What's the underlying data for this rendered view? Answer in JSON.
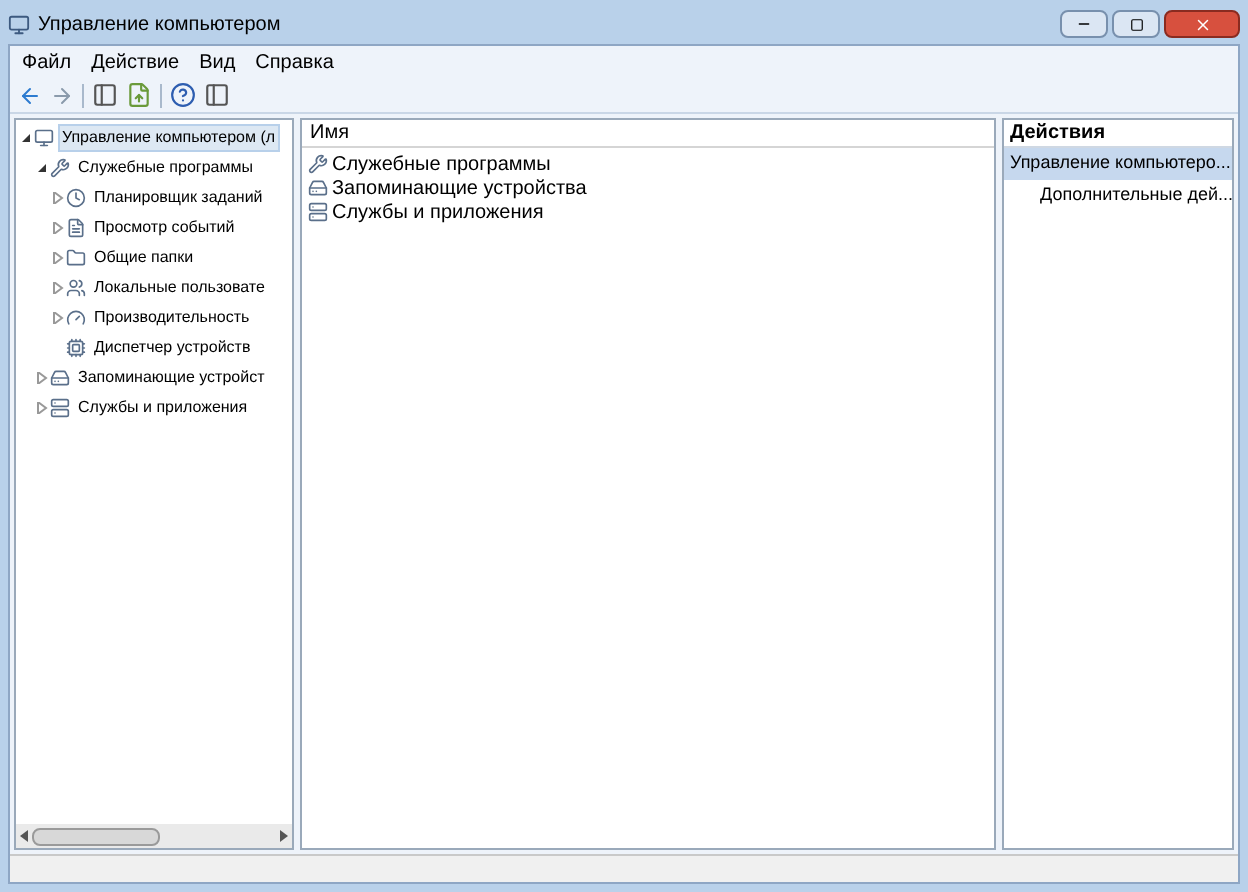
{
  "window": {
    "title": "Управление компьютером"
  },
  "menu": [
    "Файл",
    "Действие",
    "Вид",
    "Справка"
  ],
  "tree": [
    {
      "label": "Управление компьютером (л",
      "selected": true,
      "expanded": true,
      "children": [
        {
          "label": "Служебные программы",
          "selected": false,
          "expanded": true,
          "children": [
            {
              "label": "Планировщик заданий",
              "selected": false,
              "expanded": false
            },
            {
              "label": "Просмотр событий",
              "selected": false,
              "expanded": false
            },
            {
              "label": "Общие папки",
              "selected": false,
              "expanded": false
            },
            {
              "label": "Локальные пользовате",
              "selected": false,
              "expanded": false
            },
            {
              "label": "Производительность",
              "selected": false,
              "expanded": false
            },
            {
              "label": "Диспетчер устройств",
              "selected": false
            }
          ]
        },
        {
          "label": "Запоминающие устройст",
          "selected": false,
          "expanded": false
        },
        {
          "label": "Службы и приложения",
          "selected": false,
          "expanded": false
        }
      ]
    }
  ],
  "list": {
    "column": "Имя",
    "items": [
      "Служебные программы",
      "Запоминающие устройства",
      "Службы и приложения"
    ]
  },
  "actions": {
    "header": "Действия",
    "items": [
      {
        "kind": "group",
        "label": "Управление компьютеро..."
      },
      {
        "kind": "submenu",
        "label": "Дополнительные дей..."
      }
    ]
  }
}
